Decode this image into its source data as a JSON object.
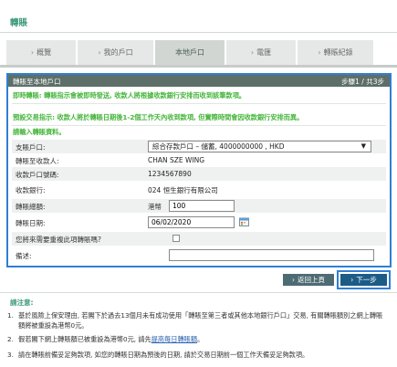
{
  "header": {
    "title": "轉賬"
  },
  "tabs": [
    {
      "label": "概覽",
      "active": false
    },
    {
      "label": "我的戶口",
      "active": false
    },
    {
      "label": "本地戶口",
      "active": true
    },
    {
      "label": "電匯",
      "active": false
    },
    {
      "label": "轉賬紀錄",
      "active": false
    }
  ],
  "panel": {
    "title": "轉賬至本地戶口",
    "step": "步驟1 / 共3步",
    "notice_immediate": "即時轉賬: 轉賬指示會被即時發送, 收款人將根據收款銀行安排而收到該筆款項。",
    "notice_scheduled": "預設交易指示: 收款人將於轉賬日期後1-2個工作天內收到款項, 但實際時間會因收款銀行安排而異。",
    "notice_input": "請輸入轉賬資料。",
    "fields": {
      "from_account_label": "支賬戶口:",
      "from_account_value": "綜合存款戶口 – 儲蓄, 4000000000 , HKD",
      "payee_label": "轉賬至收款人:",
      "payee_value": "CHAN SZE WING",
      "payee_account_label": "收款戶口號碼:",
      "payee_account_value": "1234567890",
      "payee_bank_label": "收款銀行:",
      "payee_bank_value": "024 恒生銀行有限公司",
      "amount_label": "轉賬總額:",
      "amount_currency": "港幣",
      "amount_value": "100",
      "date_label": "轉賬日期:",
      "date_value": "06/02/2020",
      "repeat_label": "您將來需要重複此項轉賬嗎?",
      "remarks_label": "備述:",
      "remarks_value": ""
    }
  },
  "buttons": {
    "back": "返回上頁",
    "next": "下一步"
  },
  "notes": {
    "title": "請注意:",
    "items": [
      {
        "num": "1.",
        "text": "基於風險上保安理由, 若閣下於過去13個月未有成功使用「轉賬至第三者或其他本地銀行戶口」交易, 有關轉賬額別之網上轉賬額將被重設為港幣0元。"
      },
      {
        "num": "2.",
        "pre": "假若閣下網上轉賬額已被重設為港幣0元, 請先",
        "link": "提高每日轉賬額",
        "post": "。"
      },
      {
        "num": "3.",
        "text": "請在轉賬前備妥足夠款項, 如您的轉賬日期為預後的日期, 請於交易日期前一個工作天備妥足夠款項。"
      }
    ]
  },
  "colors": {
    "brand_green": "#3f9a79",
    "notice_green": "#45b53b",
    "highlight_blue": "#2f7fd3",
    "next_button": "#1d5b87"
  }
}
